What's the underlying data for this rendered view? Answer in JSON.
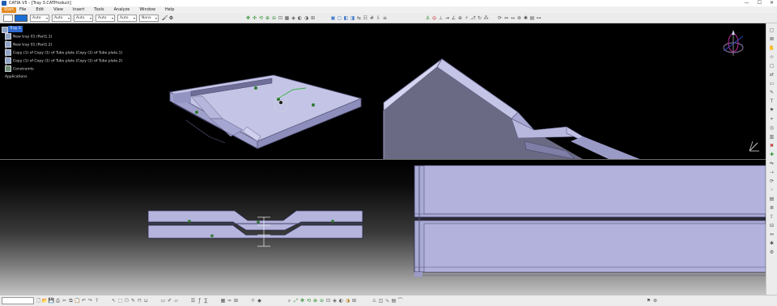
{
  "window": {
    "title": "CATIA V5 - [Tray 3.CATProduct]",
    "controls": [
      "—",
      "☐",
      "✕"
    ]
  },
  "menu": {
    "start": "Start",
    "items": [
      "File",
      "Edit",
      "View",
      "Insert",
      "Tools",
      "Analyze",
      "Window",
      "Help"
    ]
  },
  "toolbar": {
    "combos": [
      "Auto",
      "Auto",
      "Auto",
      "Auto",
      "Auto",
      "None"
    ],
    "colors": {
      "fill": "#1a6fd6"
    }
  },
  "tree": {
    "root": "Tray 3",
    "items": [
      "New tray 01 (Part1.1)",
      "New tray 01 (Part1.2)",
      "Copy (1) of Copy (1) of Tube plate (Copy (1) of Tube plate.1)",
      "Copy (1) of Copy (1) of Tube plate (Copy (1) of Tube plate.2)",
      "Constraints",
      "Applications"
    ]
  },
  "colors": {
    "part_face": "#aeaed6",
    "part_top": "#c4c4e6",
    "part_edge": "#5a5a80",
    "selection": "#2f6bd0",
    "accent_green": "#3cb44b"
  },
  "icons": {
    "compass": "compass-icon",
    "axis": "axis-icon"
  }
}
